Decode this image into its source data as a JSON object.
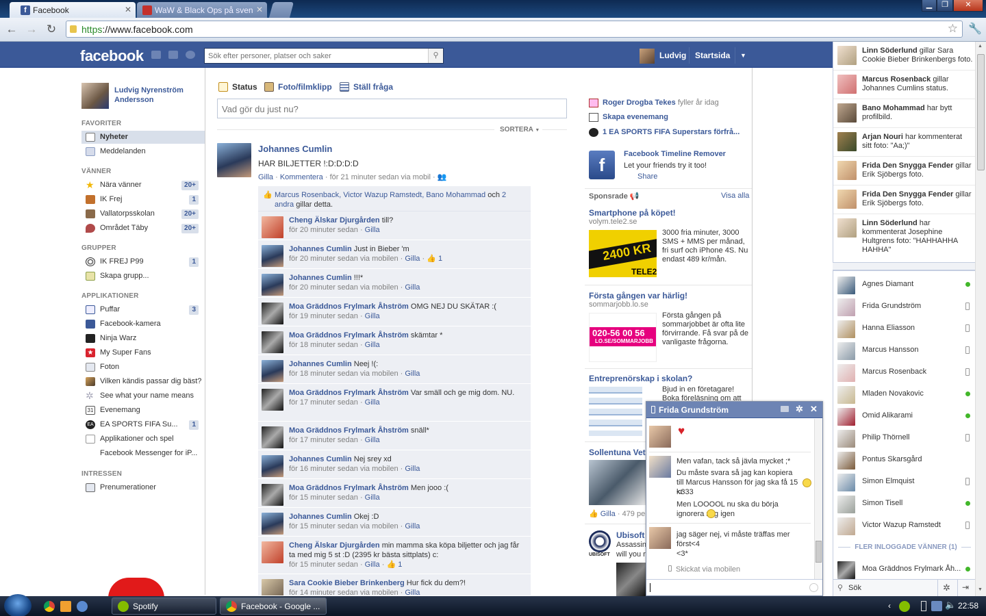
{
  "browser": {
    "tabs": [
      {
        "title": "Facebook",
        "active": true
      },
      {
        "title": "WaW & Black Ops på sven",
        "active": false
      }
    ],
    "url_scheme": "https",
    "url_rest": "://www.facebook.com"
  },
  "fb": {
    "logo": "facebook",
    "search_placeholder": "Sök efter personer, platser och saker",
    "user": "Ludvig",
    "home": "Startsida"
  },
  "left": {
    "profile_name": "Ludvig Nyrenström Andersson",
    "favorites_title": "FAVORITER",
    "favorites": [
      {
        "label": "Nyheter",
        "count": ""
      },
      {
        "label": "Meddelanden",
        "count": ""
      }
    ],
    "friends_title": "VÄNNER",
    "friends": [
      {
        "label": "Nära vänner",
        "count": "20+"
      },
      {
        "label": "IK Frej",
        "count": "1"
      },
      {
        "label": "Vallatorpsskolan",
        "count": "20+"
      },
      {
        "label": "Området Täby",
        "count": "20+"
      }
    ],
    "groups_title": "GRUPPER",
    "groups": [
      {
        "label": "IK FREJ P99",
        "count": "1"
      },
      {
        "label": "Skapa grupp...",
        "count": ""
      }
    ],
    "apps_title": "APPLIKATIONER",
    "apps": [
      {
        "label": "Puffar",
        "count": "3"
      },
      {
        "label": "Facebook-kamera",
        "count": ""
      },
      {
        "label": "Ninja Warz",
        "count": ""
      },
      {
        "label": "My Super Fans",
        "count": ""
      },
      {
        "label": "Foton",
        "count": ""
      },
      {
        "label": "Vilken kändis passar dig bäst?",
        "count": ""
      },
      {
        "label": "See what your name means",
        "count": ""
      },
      {
        "label": "Evenemang",
        "count": ""
      },
      {
        "label": "EA SPORTS FIFA Su...",
        "count": "1"
      },
      {
        "label": "Applikationer och spel",
        "count": ""
      },
      {
        "label": "Facebook Messenger for iP...",
        "count": ""
      }
    ],
    "interests_title": "INTRESSEN",
    "interests": [
      {
        "label": "Prenumerationer",
        "count": ""
      }
    ]
  },
  "composer": {
    "status": "Status",
    "photo": "Foto/filmklipp",
    "question": "Ställ fråga",
    "placeholder": "Vad gör du just nu?",
    "sort": "SORTERA"
  },
  "post": {
    "author": "Johannes Cumlin",
    "text": "HAR BILJETTER !:D:D:D:D",
    "like": "Gilla",
    "comment": "Kommentera",
    "time": "för 21 minuter sedan via mobil",
    "likes_names": "Marcus Rosenback, Victor Wazup Ramstedt, Bano Mohammad",
    "likes_och": "och",
    "likes_others": "2 andra",
    "likes_suffix": "gillar detta."
  },
  "comments": [
    {
      "name": "Cheng Älskar Djurgården",
      "text": "till?",
      "meta": "för 20 minuter sedan",
      "likes": ""
    },
    {
      "name": "Johannes Cumlin",
      "text": "Just in Bieber 'm",
      "meta": "för 20 minuter sedan via mobilen",
      "likes": "1"
    },
    {
      "name": "Johannes Cumlin",
      "text": "!!!*",
      "meta": "för 20 minuter sedan via mobilen",
      "likes": ""
    },
    {
      "name": "Moa Gräddnos Frylmark Åhström",
      "text": "OMG NEJ DU SKÄTAR :(",
      "meta": "för 19 minuter sedan",
      "likes": ""
    },
    {
      "name": "Moa Gräddnos Frylmark Åhström",
      "text": "skämtar *",
      "meta": "för 18 minuter sedan",
      "likes": ""
    },
    {
      "name": "Johannes Cumlin",
      "text": "Neej !(:",
      "meta": "för 18 minuter sedan via mobilen",
      "likes": ""
    },
    {
      "name": "Moa Gräddnos Frylmark Åhström",
      "text": "Var smäll och ge mig dom. NU.",
      "meta": "för 17 minuter sedan",
      "likes": ""
    },
    {
      "name": "Moa Gräddnos Frylmark Åhström",
      "text": "snäll*",
      "meta": "för 17 minuter sedan",
      "likes": ""
    },
    {
      "name": "Johannes Cumlin",
      "text": "Nej srey xd",
      "meta": "för 16 minuter sedan via mobilen",
      "likes": ""
    },
    {
      "name": "Moa Gräddnos Frylmark Åhström",
      "text": "Men jooo :(",
      "meta": "för 15 minuter sedan",
      "likes": ""
    },
    {
      "name": "Johannes Cumlin",
      "text": "Okej :D",
      "meta": "för 15 minuter sedan via mobilen",
      "likes": ""
    },
    {
      "name": "Cheng Älskar Djurgården",
      "text": "min mamma ska köpa biljetter och jag får ta med mig 5 st :D (2395 kr bästa sittplats) c:",
      "meta": "för 15 minuter sedan",
      "likes": "1"
    },
    {
      "name": "Sara Cookie Bieber Brinkenberg",
      "text": "Hur fick du dem?!",
      "meta": "för 14 minuter sedan via mobilen",
      "likes": ""
    }
  ],
  "comment_like": "Gilla",
  "right": {
    "events": [
      {
        "name": "Roger Drogba Tekes",
        "rest": "fyller år idag"
      },
      {
        "name": "Skapa evenemang",
        "rest": ""
      },
      {
        "name": "1 EA SPORTS FIFA Superstars förfrå...",
        "rest": ""
      }
    ],
    "promo_title": "Facebook Timeline Remover",
    "promo_text": "Let your friends try it too!",
    "promo_share": "Share",
    "sponsored": "Sponsrade",
    "see_all": "Visa alla",
    "ads": [
      {
        "title": "Smartphone på köpet!",
        "domain": "volym.tele2.se",
        "body": "3000 fria minuter, 3000 SMS + MMS per månad, fri surf och iPhone 4S. Nu endast 489 kr/mån.",
        "img_text": "2400 KR",
        "img_brand": "TELE2"
      },
      {
        "title": "Första gången var härlig!",
        "domain": "sommarjobb.lo.se",
        "body": "Första gången på sommarjobbet är ofta lite förvirrande. Få svar på de vanligaste frågorna.",
        "img_text": "020-56 00 56",
        "img_brand": "LO.SE/SOMMARJOBB"
      },
      {
        "title": "Entreprenörskap i skolan?",
        "domain": "",
        "body": "Bjud in en företagare! Boka föreläsning om att",
        "img_text": "",
        "img_brand": ""
      },
      {
        "title": "Sollentuna Vet",
        "domain": "",
        "body": "",
        "img_text": "",
        "img_brand": ""
      }
    ],
    "sollentuna_like": "Gilla",
    "sollentuna_count": "· 479 pers",
    "ubisoft_title": "Ubisoft",
    "ubisoft_body1": "Assassin'",
    "ubisoft_body2": "will you r",
    "ubisoft_logo": "UBISOFT"
  },
  "ticker": [
    {
      "name": "Linn Söderlund",
      "rest": "gillar Sara Cookie Bieber Brinkenbergs foto."
    },
    {
      "name": "Marcus Rosenback",
      "rest": "gillar Johannes Cumlins status."
    },
    {
      "name": "Bano Mohammad",
      "rest": "har bytt profilbild."
    },
    {
      "name": "Arjan Nouri",
      "rest": "har kommenterat sitt foto: \"Aa;)\""
    },
    {
      "name": "Frida Den Snygga Fender",
      "rest": "gillar Erik Sjöbergs foto."
    },
    {
      "name": "Frida Den Snygga Fender",
      "rest": "gillar Erik Sjöbergs foto."
    },
    {
      "name": "Linn Söderlund",
      "rest": "har kommenterat Josephine Hultgrens foto: \"HAHHAHHA HAHHA\""
    }
  ],
  "chat": {
    "online": [
      {
        "name": "Agnes Diamant",
        "status": "online"
      },
      {
        "name": "Frida Grundström",
        "status": "mobile"
      },
      {
        "name": "Hanna Eliasson",
        "status": "mobile"
      },
      {
        "name": "Marcus Hansson",
        "status": "mobile"
      },
      {
        "name": "Marcus Rosenback",
        "status": "mobile"
      },
      {
        "name": "Mladen Novakovic",
        "status": "online"
      },
      {
        "name": "Omid Alikarami",
        "status": "online"
      },
      {
        "name": "Philip Thörnell",
        "status": "mobile"
      },
      {
        "name": "Pontus Skarsgård",
        "status": ""
      },
      {
        "name": "Simon Elmquist",
        "status": "mobile"
      },
      {
        "name": "Simon Tisell",
        "status": "online"
      },
      {
        "name": "Victor Wazup Ramstedt",
        "status": "mobile"
      }
    ],
    "more_title": "FLER INLOGGADE VÄNNER (1)",
    "more": [
      {
        "name": "Moa Gräddnos Frylmark Åh...",
        "status": "online"
      }
    ],
    "search_placeholder": "Sök"
  },
  "chatwin": {
    "title": "Frida Grundström",
    "heart": "♥",
    "msg1": "Men vafan, tack så jävla mycket ;*",
    "msg2": "Du måste svara så jag kan kopiera till Marcus Hansson för jag ska få 15 kr",
    "msg2b": "<333",
    "msg3": "Men LOOOOL nu ska du börja ignorera mig igen",
    "msg4": "jag säger nej, vi måste träffas mer först<4",
    "msg4b": "<3*",
    "sent_via": "Skickat via mobilen"
  },
  "taskbar": {
    "spotify": "Spotify",
    "chrome": "Facebook - Google ...",
    "clock": "22:58"
  }
}
